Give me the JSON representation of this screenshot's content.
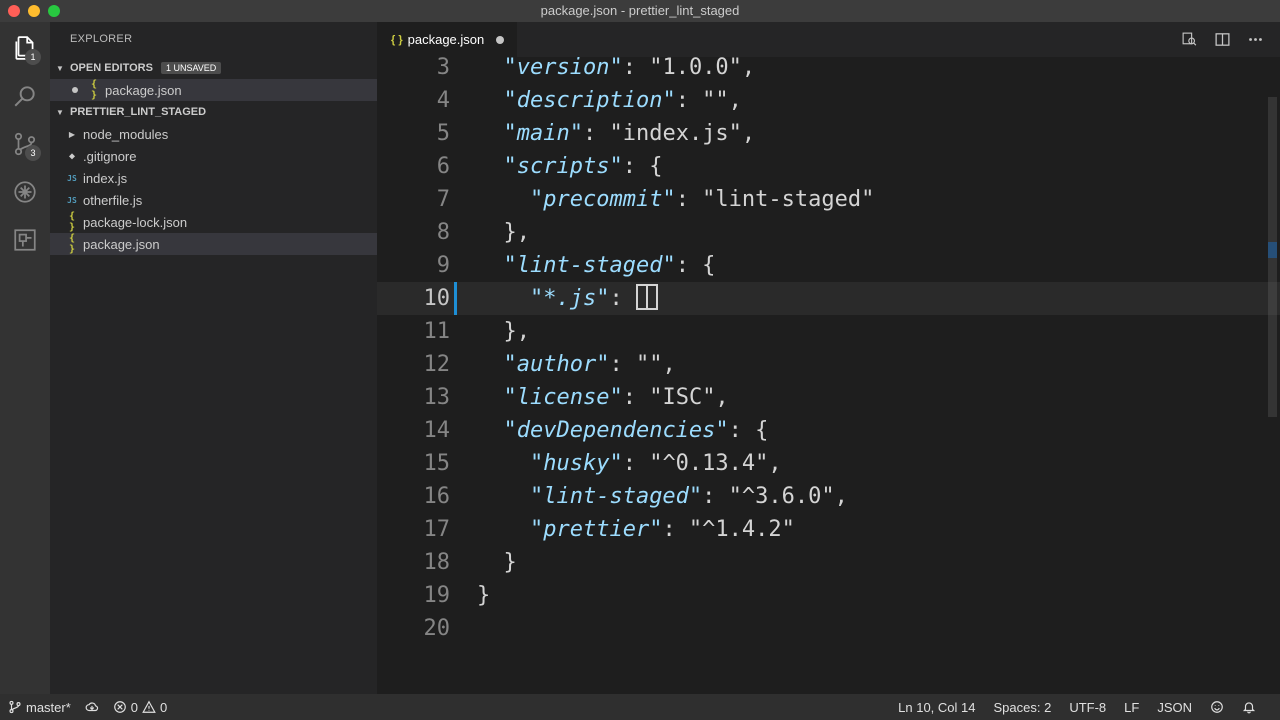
{
  "window": {
    "title": "package.json - prettier_lint_staged"
  },
  "activity": {
    "explorer_badge": "1",
    "scm_badge": "3"
  },
  "sidebar": {
    "title": "EXPLORER",
    "open_editors": {
      "label": "OPEN EDITORS",
      "badge": "1 UNSAVED",
      "items": [
        {
          "name": "package.json",
          "icon": "{ }"
        }
      ]
    },
    "project": {
      "label": "PRETTIER_LINT_STAGED",
      "items": [
        {
          "name": "node_modules",
          "icon": "folder-caret",
          "glyph": "▶"
        },
        {
          "name": ".gitignore",
          "icon": "git-icon",
          "glyph": "◆"
        },
        {
          "name": "index.js",
          "icon": "js-icon",
          "glyph": "JS"
        },
        {
          "name": "otherfile.js",
          "icon": "js-icon",
          "glyph": "JS"
        },
        {
          "name": "package-lock.json",
          "icon": "json-icon",
          "glyph": "{ }"
        },
        {
          "name": "package.json",
          "icon": "json-icon",
          "glyph": "{ }"
        }
      ]
    }
  },
  "editor": {
    "tab": {
      "label": "package.json",
      "icon": "{ }"
    },
    "lines": [
      {
        "n": "3",
        "indent": "  ",
        "key": "\"version\"",
        "rest": ": \"1.0.0\","
      },
      {
        "n": "4",
        "indent": "  ",
        "key": "\"description\"",
        "rest": ": \"\","
      },
      {
        "n": "5",
        "indent": "  ",
        "key": "\"main\"",
        "rest": ": \"index.js\","
      },
      {
        "n": "6",
        "indent": "  ",
        "key": "\"scripts\"",
        "rest": ": {"
      },
      {
        "n": "7",
        "indent": "    ",
        "key": "\"precommit\"",
        "rest": ": \"lint-staged\""
      },
      {
        "n": "8",
        "indent": "  ",
        "key": "",
        "rest": "},"
      },
      {
        "n": "9",
        "indent": "  ",
        "key": "\"lint-staged\"",
        "rest": ": {"
      },
      {
        "n": "10",
        "indent": "    ",
        "key": "\"*.js\"",
        "rest": ": "
      },
      {
        "n": "11",
        "indent": "  ",
        "key": "",
        "rest": "},"
      },
      {
        "n": "12",
        "indent": "  ",
        "key": "\"author\"",
        "rest": ": \"\","
      },
      {
        "n": "13",
        "indent": "  ",
        "key": "\"license\"",
        "rest": ": \"ISC\","
      },
      {
        "n": "14",
        "indent": "  ",
        "key": "\"devDependencies\"",
        "rest": ": {"
      },
      {
        "n": "15",
        "indent": "    ",
        "key": "\"husky\"",
        "rest": ": \"^0.13.4\","
      },
      {
        "n": "16",
        "indent": "    ",
        "key": "\"lint-staged\"",
        "rest": ": \"^3.6.0\","
      },
      {
        "n": "17",
        "indent": "    ",
        "key": "\"prettier\"",
        "rest": ": \"^1.4.2\""
      },
      {
        "n": "18",
        "indent": "  ",
        "key": "",
        "rest": "}"
      },
      {
        "n": "19",
        "indent": "",
        "key": "",
        "rest": "}"
      },
      {
        "n": "20",
        "indent": "",
        "key": "",
        "rest": ""
      }
    ],
    "current_line": "10"
  },
  "status": {
    "branch": "master*",
    "errors": "0",
    "warnings": "0",
    "position": "Ln 10, Col 14",
    "spaces": "Spaces: 2",
    "encoding": "UTF-8",
    "eol": "LF",
    "language": "JSON"
  },
  "colors": {
    "accent": "#1e8fd6",
    "key": "#9cdcfe",
    "json_icon": "#cbcb41",
    "js_icon": "#519aba"
  }
}
